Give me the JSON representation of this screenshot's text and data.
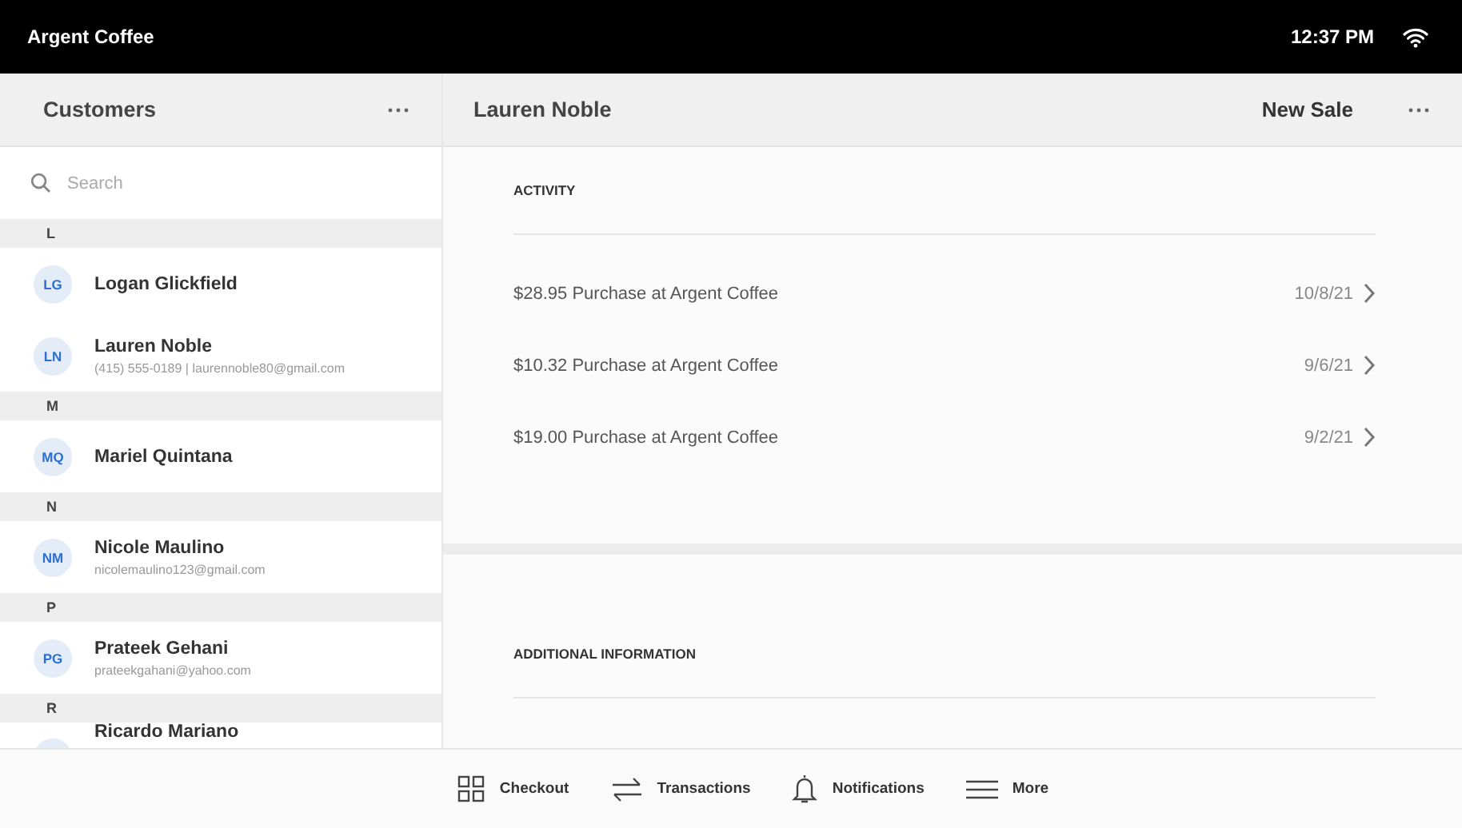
{
  "status_bar": {
    "title": "Argent Coffee",
    "time": "12:37 PM"
  },
  "customers_panel": {
    "title": "Customers",
    "search": {
      "placeholder": "Search"
    },
    "groups": [
      {
        "letter": "L",
        "customers": [
          {
            "initials": "LG",
            "name": "Logan Glickfield"
          },
          {
            "initials": "LN",
            "name": "Lauren Noble",
            "detail": "(415) 555-0189 | laurennoble80@gmail.com"
          }
        ]
      },
      {
        "letter": "M",
        "customers": [
          {
            "initials": "MQ",
            "name": "Mariel Quintana"
          }
        ]
      },
      {
        "letter": "N",
        "customers": [
          {
            "initials": "NM",
            "name": "Nicole Maulino",
            "detail": "nicolemaulino123@gmail.com"
          }
        ]
      },
      {
        "letter": "P",
        "customers": [
          {
            "initials": "PG",
            "name": "Prateek Gehani",
            "detail": "prateekgahani@yahoo.com"
          }
        ]
      },
      {
        "letter": "R",
        "customers": [
          {
            "name": "Ricardo Mariano"
          }
        ]
      }
    ]
  },
  "detail_panel": {
    "title": "Lauren Noble",
    "action": "New Sale",
    "activity_heading": "ACTIVITY",
    "activity": [
      {
        "text": "$28.95 Purchase at Argent Coffee",
        "date": "10/8/21"
      },
      {
        "text": "$10.32 Purchase at Argent Coffee",
        "date": "9/6/21"
      },
      {
        "text": "$19.00 Purchase at Argent Coffee",
        "date": "9/2/21"
      }
    ],
    "additional_heading": "ADDITIONAL INFORMATION"
  },
  "bottom_nav": [
    {
      "kind": "grid",
      "label": "Checkout"
    },
    {
      "kind": "arrows",
      "label": "Transactions"
    },
    {
      "kind": "bell",
      "label": "Notifications"
    },
    {
      "kind": "lines",
      "label": "More"
    }
  ]
}
